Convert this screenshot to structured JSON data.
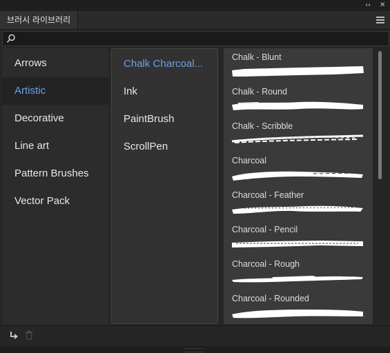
{
  "window": {
    "collapse_glyph": "‹‹",
    "close_glyph": "✕"
  },
  "panel": {
    "title": "브러시 라이브러리"
  },
  "search": {
    "value": "",
    "placeholder": ""
  },
  "categories": [
    {
      "label": "Arrows",
      "selected": false
    },
    {
      "label": "Artistic",
      "selected": true
    },
    {
      "label": "Decorative",
      "selected": false
    },
    {
      "label": "Line art",
      "selected": false
    },
    {
      "label": "Pattern Brushes",
      "selected": false
    },
    {
      "label": "Vector Pack",
      "selected": false
    }
  ],
  "subcategories": [
    {
      "label": "Chalk Charcoal...",
      "selected": true
    },
    {
      "label": "Ink",
      "selected": false
    },
    {
      "label": "PaintBrush",
      "selected": false
    },
    {
      "label": "ScrollPen",
      "selected": false
    }
  ],
  "brushes": [
    {
      "label": "Chalk - Blunt"
    },
    {
      "label": "Chalk - Round"
    },
    {
      "label": "Chalk - Scribble"
    },
    {
      "label": "Charcoal"
    },
    {
      "label": "Charcoal - Feather"
    },
    {
      "label": "Charcoal - Pencil"
    },
    {
      "label": "Charcoal - Rough"
    },
    {
      "label": "Charcoal - Rounded"
    }
  ],
  "colors": {
    "accent": "#6aa2e6",
    "panel_bg": "#262626",
    "stroke": "#ffffff"
  },
  "icons": {
    "search": "search-icon",
    "menu": "panel-menu-icon",
    "place": "place-brush-icon",
    "delete": "trash-icon"
  }
}
